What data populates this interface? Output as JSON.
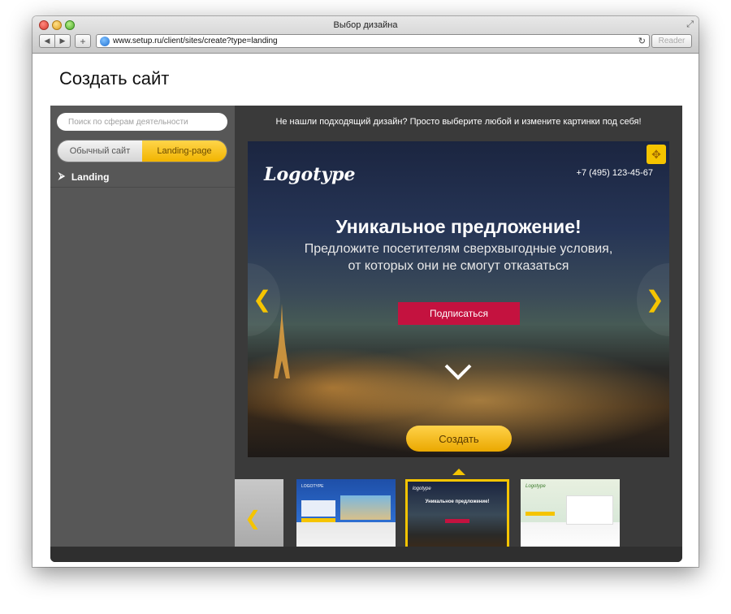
{
  "window": {
    "title": "Выбор дизайна",
    "url": "www.setup.ru/client/sites/create?type=landing",
    "reader_label": "Reader"
  },
  "page": {
    "title": "Создать сайт"
  },
  "sidebar": {
    "search_placeholder": "Поиск по сферам деятельности",
    "toggle": {
      "normal_label": "Обычный сайт",
      "landing_label": "Landing-page",
      "selected": "landing"
    },
    "categories": [
      {
        "label": "Landing",
        "icon": "landing-arrow-icon"
      }
    ]
  },
  "main": {
    "hint": "Не нашли подходящий дизайн? Просто выберите любой и измените картинки под себя!",
    "preview": {
      "logo": "Logotype",
      "phone": "+7 (495) 123-45-67",
      "headline": "Уникальное предложение!",
      "subline1": "Предложите посетителям сверхвыгодные условия,",
      "subline2": "от которых они не смогут отказаться",
      "cta_label": "Подписаться",
      "create_label": "Создать"
    },
    "thumbnails": [
      {
        "logo": ""
      },
      {
        "logo": "LOGOTYPE"
      },
      {
        "logo": "logotype",
        "headline": "Уникальное предложение!"
      },
      {
        "logo": "Logotype"
      }
    ]
  },
  "colors": {
    "accent": "#f5c400",
    "cta": "#c4123f",
    "panel": "#575757",
    "background": "#3a3a3a"
  }
}
